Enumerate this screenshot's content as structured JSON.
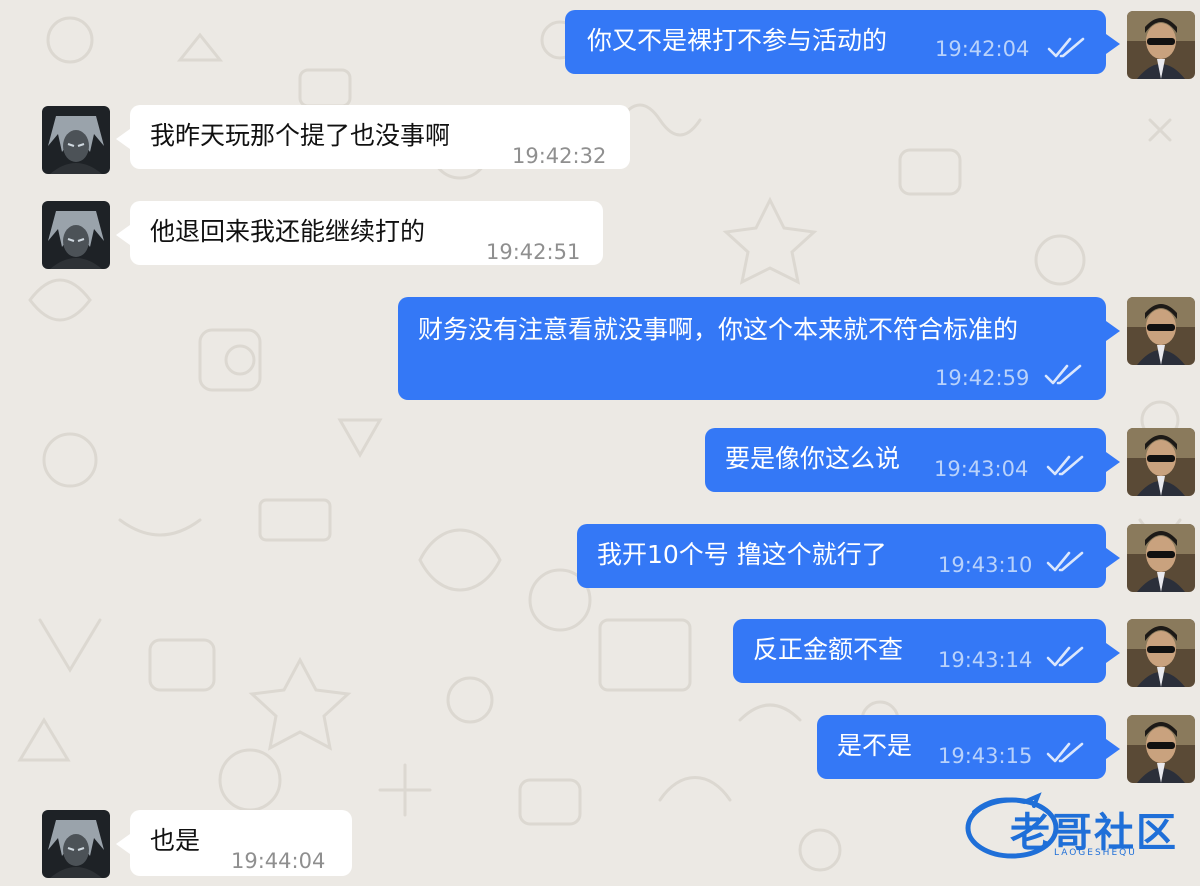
{
  "chat": {
    "messages": [
      {
        "direction": "out",
        "text": "你又不是裸打不参与活动的",
        "time": "19:42:04",
        "status": "read"
      },
      {
        "direction": "in",
        "text": "我昨天玩那个提了也没事啊",
        "time": "19:42:32"
      },
      {
        "direction": "in",
        "text": "他退回来我还能继续打的",
        "time": "19:42:51"
      },
      {
        "direction": "out",
        "text": "财务没有注意看就没事啊，你这个本来就不符合标准的",
        "time": "19:42:59",
        "status": "read"
      },
      {
        "direction": "out",
        "text": "要是像你这么说",
        "time": "19:43:04",
        "status": "read"
      },
      {
        "direction": "out",
        "text": "我开10个号 撸这个就行了",
        "time": "19:43:10",
        "status": "read"
      },
      {
        "direction": "out",
        "text": "反正金额不查",
        "time": "19:43:14",
        "status": "read"
      },
      {
        "direction": "out",
        "text": "是不是",
        "time": "19:43:15",
        "status": "read"
      },
      {
        "direction": "in",
        "text": "也是",
        "time": "19:44:04"
      }
    ]
  },
  "watermark": {
    "text": "老哥社区",
    "subtext": "LAOGESHEQU"
  },
  "colors": {
    "outgoing_bubble": "#3478f6",
    "incoming_bubble": "#ffffff",
    "background": "#ece9e4"
  },
  "icons": {
    "read_receipt": "double-check-icon",
    "self_avatar": "avatar-self",
    "contact_avatar": "avatar-contact"
  }
}
